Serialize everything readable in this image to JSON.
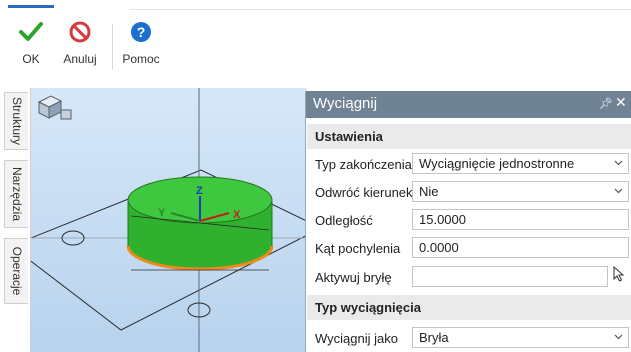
{
  "ribbon": {
    "ok_label": "OK",
    "cancel_label": "Anuluj",
    "help_label": "Pomoc"
  },
  "left_tabs": {
    "structures": "Struktury",
    "tools": "Narzędzia",
    "operations": "Operacje"
  },
  "viewport": {
    "axis_z": "Z",
    "axis_y": "Y",
    "axis_x": "X",
    "solid_color": "#2fbf2f"
  },
  "panel": {
    "title": "Wyciągnij",
    "pin_icon": "pin-icon",
    "close_icon": "close-icon",
    "settings": {
      "header": "Ustawienia",
      "end_type_label": "Typ zakończenia",
      "end_type_value": "Wyciągnięcie jednostronne",
      "reverse_label": "Odwróć kierunek",
      "reverse_value": "Nie",
      "distance_label": "Odległość",
      "distance_value": "15.0000",
      "taper_label": "Kąt pochylenia",
      "taper_value": "0.0000",
      "activate_label": "Aktywuj bryłę",
      "activate_value": ""
    },
    "extrude_type": {
      "header": "Typ wyciągnięcia",
      "as_label": "Wyciągnij jako",
      "as_value": "Bryła"
    }
  }
}
